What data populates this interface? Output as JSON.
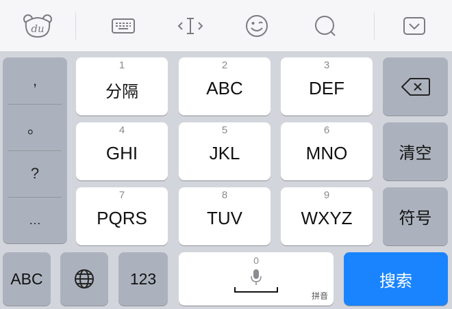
{
  "toolbar": {
    "items": [
      {
        "name": "du-logo-icon",
        "text": "du"
      },
      {
        "name": "keyboard-icon"
      },
      {
        "name": "text-cursor-icon"
      },
      {
        "name": "emoji-icon"
      },
      {
        "name": "search-icon"
      },
      {
        "name": "collapse-keyboard-icon"
      }
    ]
  },
  "punctuation": [
    ",",
    "。",
    "?",
    "…"
  ],
  "keys": {
    "k1": {
      "num": "1",
      "label": "分隔"
    },
    "k2": {
      "num": "2",
      "label": "ABC"
    },
    "k3": {
      "num": "3",
      "label": "DEF"
    },
    "k4": {
      "num": "4",
      "label": "GHI"
    },
    "k5": {
      "num": "5",
      "label": "JKL"
    },
    "k6": {
      "num": "6",
      "label": "MNO"
    },
    "k7": {
      "num": "7",
      "label": "PQRS"
    },
    "k8": {
      "num": "8",
      "label": "TUV"
    },
    "k9": {
      "num": "9",
      "label": "WXYZ"
    }
  },
  "side": {
    "clear": "清空",
    "symbols": "符号"
  },
  "bottom": {
    "abc": "ABC",
    "num_123": "123",
    "space_num": "0",
    "space_mode": "拼音",
    "search": "搜索"
  },
  "colors": {
    "accent": "#1a84ff",
    "keyboard_bg": "#d2d5db",
    "gray_key": "#acb2bd"
  }
}
